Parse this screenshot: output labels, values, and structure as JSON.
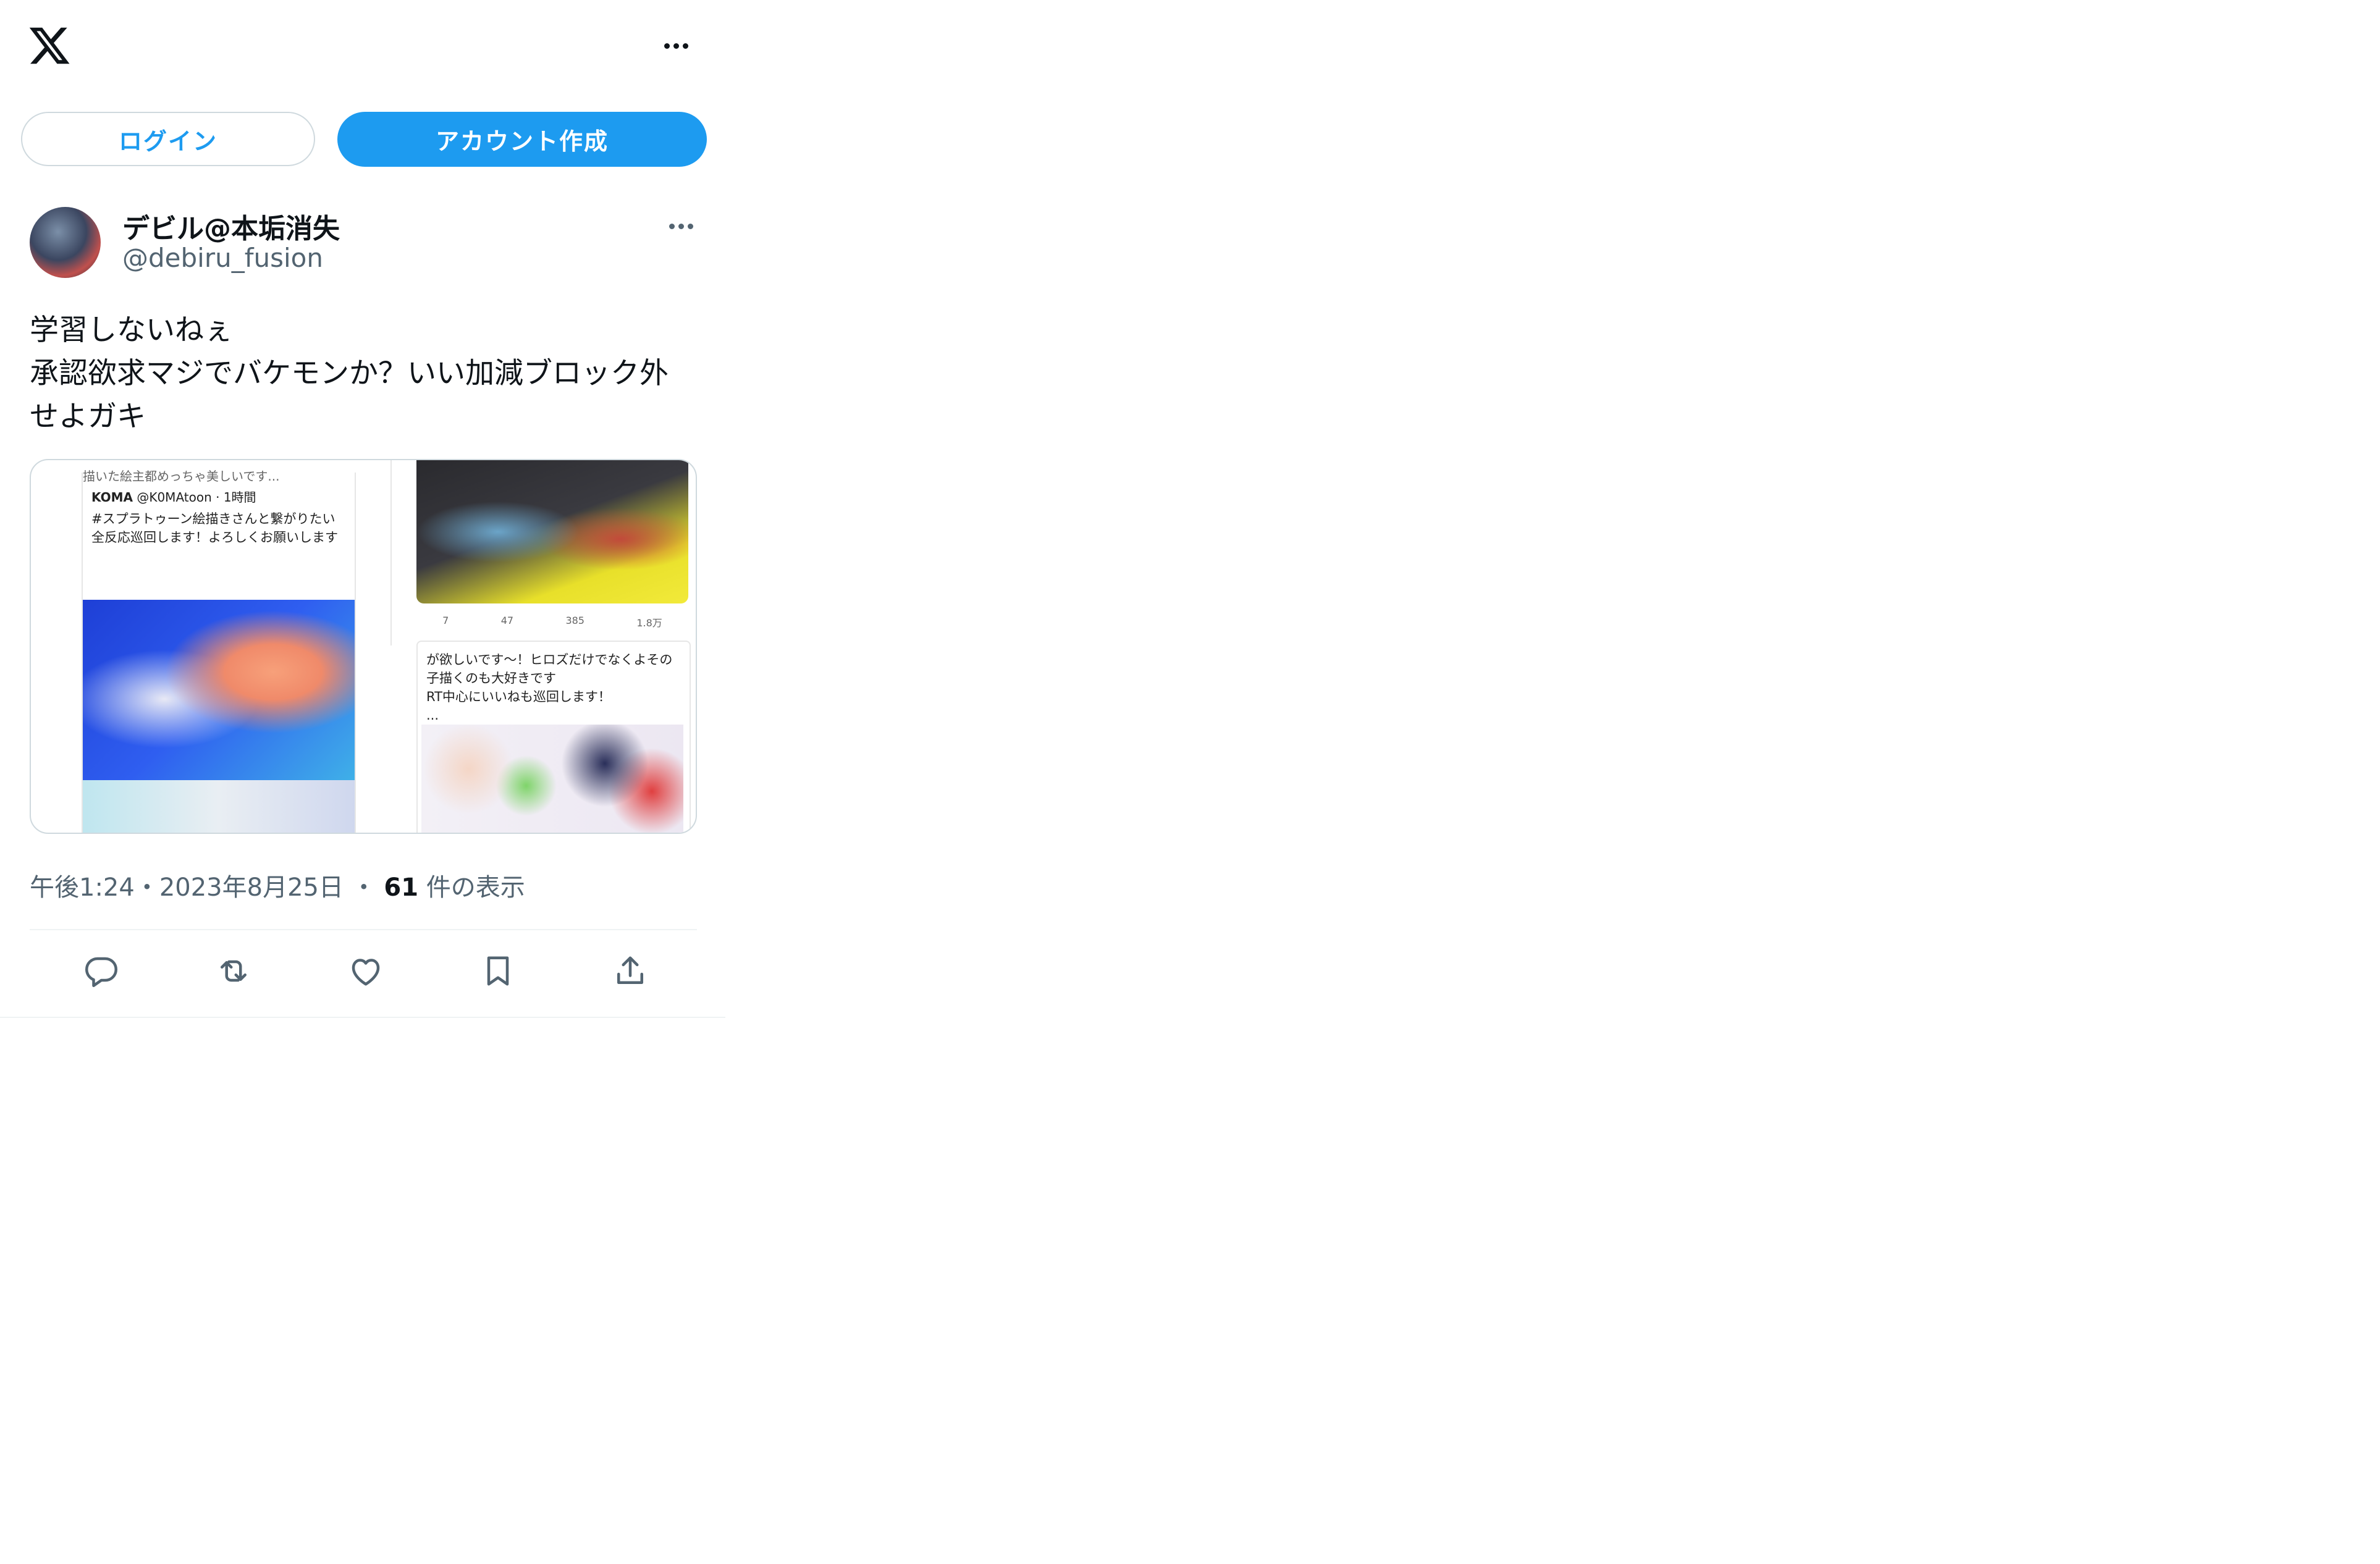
{
  "header": {
    "logo_icon": "x-logo-icon",
    "more_icon": "more-horizontal-icon"
  },
  "auth": {
    "login_label": "ログイン",
    "signup_label": "アカウント作成"
  },
  "tweet": {
    "display_name": "デビル@本垢消失",
    "handle": "@debiru_fusion",
    "text": "学習しないねぇ\n承認欲求マジでバケモンか？いい加減ブロック外\nせよガキ",
    "timestamp": "午後1:24・2023年8月25日",
    "views_separator": "・",
    "views_count": "61",
    "views_label": "件の表示",
    "media": {
      "left_top_cut": "描いた絵主都めっちゃ美しいです...",
      "left_user": "KOMA",
      "left_meta": "@K0MAtoon · 1時間",
      "left_body": "#スプラトゥーン絵描きさんと繋がりたい\n全反応巡回します！よろしくお願いします",
      "right_stats": [
        "7",
        "47",
        "385",
        "1.8万"
      ],
      "right_body": "が欲しいです〜！ヒロズだけでなくよその子描くのも大好きです\nRT中心にいいねも巡回します！\n..."
    }
  },
  "actions": [
    {
      "name": "reply",
      "icon": "reply-icon"
    },
    {
      "name": "retweet",
      "icon": "retweet-icon"
    },
    {
      "name": "like",
      "icon": "heart-icon"
    },
    {
      "name": "bookmark",
      "icon": "bookmark-icon"
    },
    {
      "name": "share",
      "icon": "share-icon"
    }
  ],
  "colors": {
    "accent": "#1d9bf0",
    "text_primary": "#0f1419",
    "text_secondary": "#536471",
    "border": "#cfd9de"
  }
}
